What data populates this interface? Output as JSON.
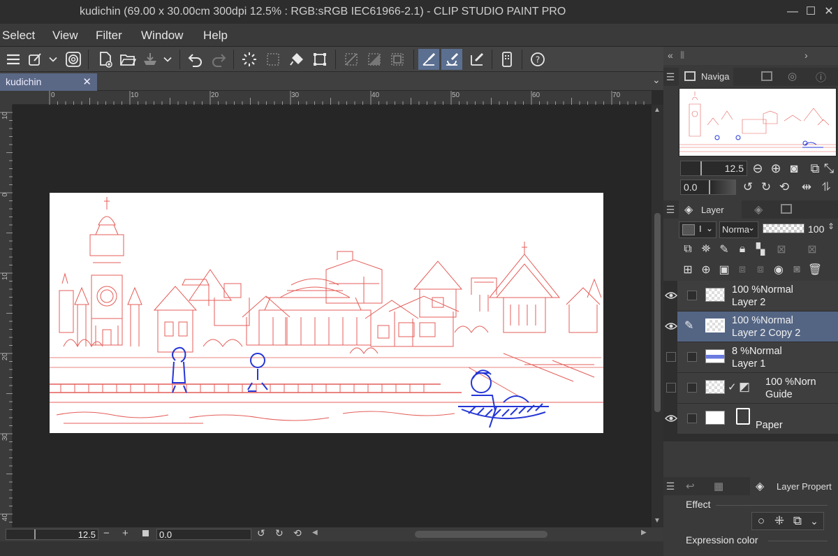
{
  "window": {
    "title": "kudichin (69.00 x 30.00cm 300dpi 12.5% : RGB:sRGB IEC61966-2.1)  - CLIP STUDIO PAINT PRO",
    "minimize": "—",
    "maximize": "☐",
    "close": "✕"
  },
  "menu": [
    "Select",
    "View",
    "Filter",
    "Window",
    "Help"
  ],
  "document_tab": {
    "name": "kudichin",
    "close": "✕",
    "dropdown": "⌄"
  },
  "rulers": {
    "top": [
      "0",
      "10",
      "20",
      "30",
      "40",
      "50",
      "60",
      "70"
    ],
    "left": [
      "10",
      "0",
      "10",
      "20",
      "30",
      "40"
    ]
  },
  "bottom_bar": {
    "zoom": "12.5",
    "minus": "−",
    "plus": "+",
    "rotation": "0.0"
  },
  "navigator": {
    "tab_label": "Naviga",
    "zoom_value": "12.5",
    "rotation_value": "0.0"
  },
  "layer_panel": {
    "tab_label": "Layer",
    "blend_mode": "Norma",
    "opacity": "100",
    "blend_small": "I",
    "layers": [
      {
        "percent": "100 %",
        "mode": "Normal",
        "name": "Layer 2",
        "visible": true,
        "selected": false
      },
      {
        "percent": "100 %",
        "mode": "Normal",
        "name": "Layer 2 Copy 2",
        "visible": true,
        "selected": true
      },
      {
        "percent": "8 %",
        "mode": "Normal",
        "name": "Layer 1",
        "visible": false,
        "selected": false
      },
      {
        "percent": "100 %",
        "mode": "Norn",
        "name": "Guide",
        "visible": false,
        "selected": false
      },
      {
        "percent": "",
        "mode": "",
        "name": "Paper",
        "visible": true,
        "selected": false
      }
    ]
  },
  "layer_property": {
    "tab_label": "Layer Propert",
    "effect_label": "Effect",
    "expression_color_label": "Expression color"
  },
  "colors": {
    "accent": "#5b6f91",
    "sketch_red": "#e0413b",
    "sketch_blue": "#2436d6"
  }
}
